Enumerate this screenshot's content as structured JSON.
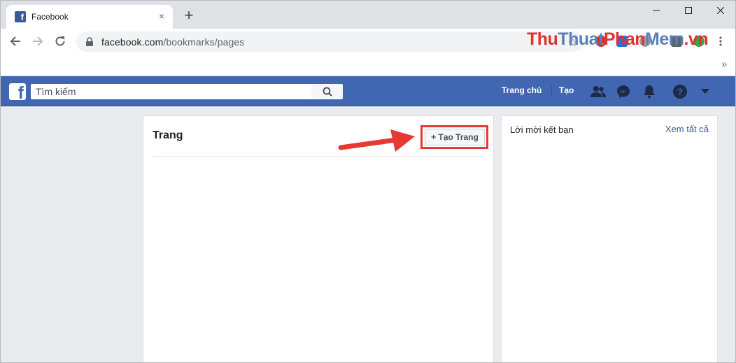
{
  "browser": {
    "tab_title": "Facebook",
    "tab_close": "×",
    "new_tab": "+",
    "url_host": "facebook.com",
    "url_path": "/bookmarks/pages",
    "bookmarks_overflow": "»",
    "icons": [
      "back-arrow-icon",
      "forward-arrow-icon",
      "reload-icon",
      "lock-icon",
      "star-icon",
      "adblock-icon",
      "new-extension-icon",
      "menu-icon"
    ]
  },
  "watermark": {
    "part_a": "Thu",
    "part_b": "Thuat",
    "part_c": "Phan",
    "part_d": "Mem",
    "part_e": ".vn"
  },
  "facebook": {
    "search_placeholder": "Tìm kiếm",
    "nav_home": "Trang chủ",
    "nav_create": "Tạo",
    "brand_color": "#4267b2"
  },
  "pages_card": {
    "title": "Trang",
    "create_button": "+ Tạo Trang"
  },
  "friend_requests": {
    "title": "Lời mời kết bạn",
    "see_all": "Xem tất cả"
  }
}
